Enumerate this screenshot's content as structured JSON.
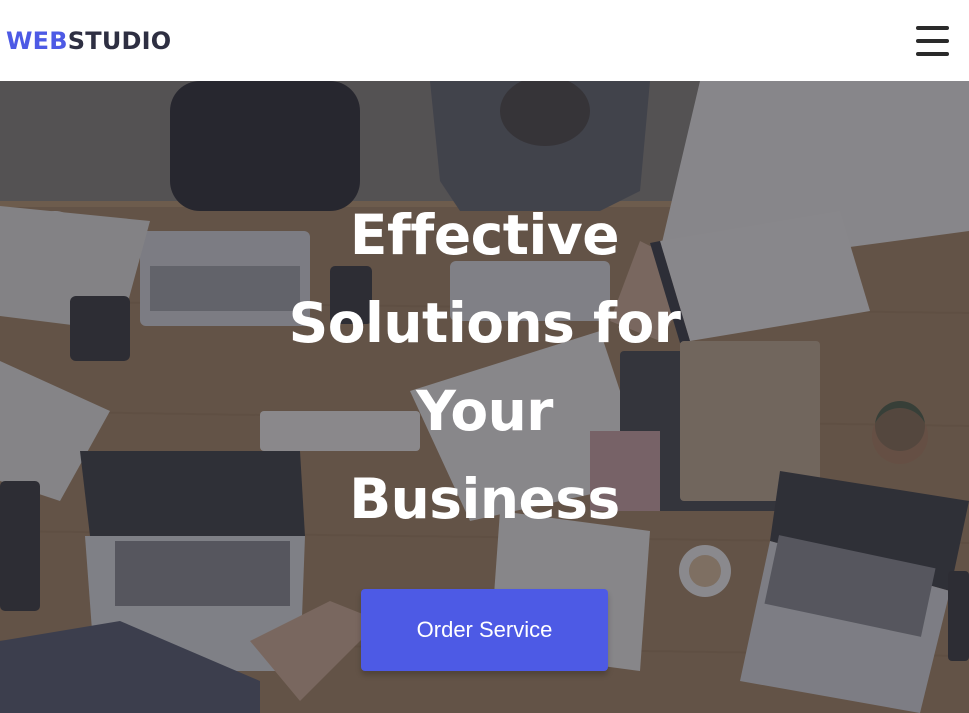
{
  "header": {
    "logo_accent": "WEB",
    "logo_rest": "STUDIO",
    "menu_icon": "hamburger-menu-icon"
  },
  "hero": {
    "title": "Effective Solutions for Your Business",
    "cta_label": "Order Service",
    "background_image": "overhead view of a wooden office table with laptops, notebooks, coffee cups and people's hands"
  },
  "colors": {
    "accent": "#4d5ae5",
    "logo_dark": "#2e2f42",
    "hero_text": "#ffffff"
  }
}
